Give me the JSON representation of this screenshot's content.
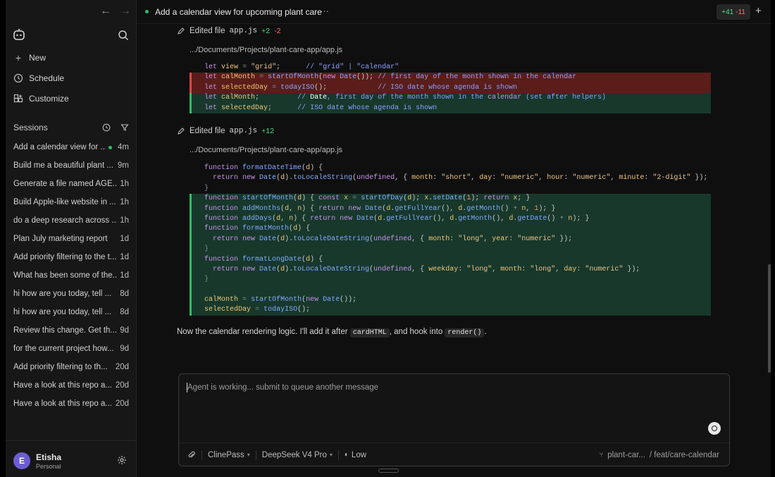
{
  "sidebar": {
    "nav": {
      "back": "←",
      "forward": "→"
    },
    "menu": [
      {
        "label": "New",
        "icon": "plus-icon"
      },
      {
        "label": "Schedule",
        "icon": "clock-icon"
      },
      {
        "label": "Customize",
        "icon": "customize-icon"
      }
    ],
    "sessions_label": "Sessions",
    "sessions": [
      {
        "title": "Add a calendar view for ...",
        "age": "4m",
        "active": true
      },
      {
        "title": "Build me a beautiful plant ...",
        "age": "9m"
      },
      {
        "title": "Generate a file named AGE...",
        "age": "1h"
      },
      {
        "title": "Build Apple-like website in ...",
        "age": "1h"
      },
      {
        "title": "do a deep research across ...",
        "age": "1h"
      },
      {
        "title": "Plan July marketing report",
        "age": "1d"
      },
      {
        "title": "Add priority filtering to the t...",
        "age": "1d"
      },
      {
        "title": "What has been some of the...",
        "age": "1d"
      },
      {
        "title": "hi how are you today, tell ...",
        "age": "8d"
      },
      {
        "title": "hi how are you today, tell ...",
        "age": "8d"
      },
      {
        "title": "Review this change. Get th...",
        "age": "9d"
      },
      {
        "title": "for the current project how...",
        "age": "9d"
      },
      {
        "title": "Add priority filtering to th...",
        "age": "20d"
      },
      {
        "title": "Have a look at this repo a...",
        "age": "20d"
      },
      {
        "title": "Have a look at this repo a...",
        "age": "20d"
      }
    ],
    "user": {
      "initial": "E",
      "name": "Etisha",
      "plan": "Personal"
    }
  },
  "header": {
    "title": "Add a calendar view for upcoming plant care",
    "more": "···",
    "diff_add": "+41",
    "diff_del": "-11",
    "plus": "+"
  },
  "edits": [
    {
      "label": "Edited file",
      "file": "app.js",
      "add": "+2",
      "del": "-2",
      "path": ".../Documents/Projects/plant-care-app/app.js"
    },
    {
      "label": "Edited file",
      "file": "app.js",
      "add": "+12",
      "del": "",
      "path": ".../Documents/Projects/plant-care-app/app.js"
    }
  ],
  "narration": {
    "before": "Now the calendar rendering logic. I'll add it after ",
    "code1": "cardHTML",
    "middle": ", and hook into ",
    "code2": "render()",
    "after": "."
  },
  "composer": {
    "placeholder": "Agent is working... submit to queue another message",
    "account": "ClinePass",
    "model": "DeepSeek V4 Pro",
    "effort": "Low",
    "repo": "plant-car...",
    "branch": "/ feat/care-calendar"
  }
}
